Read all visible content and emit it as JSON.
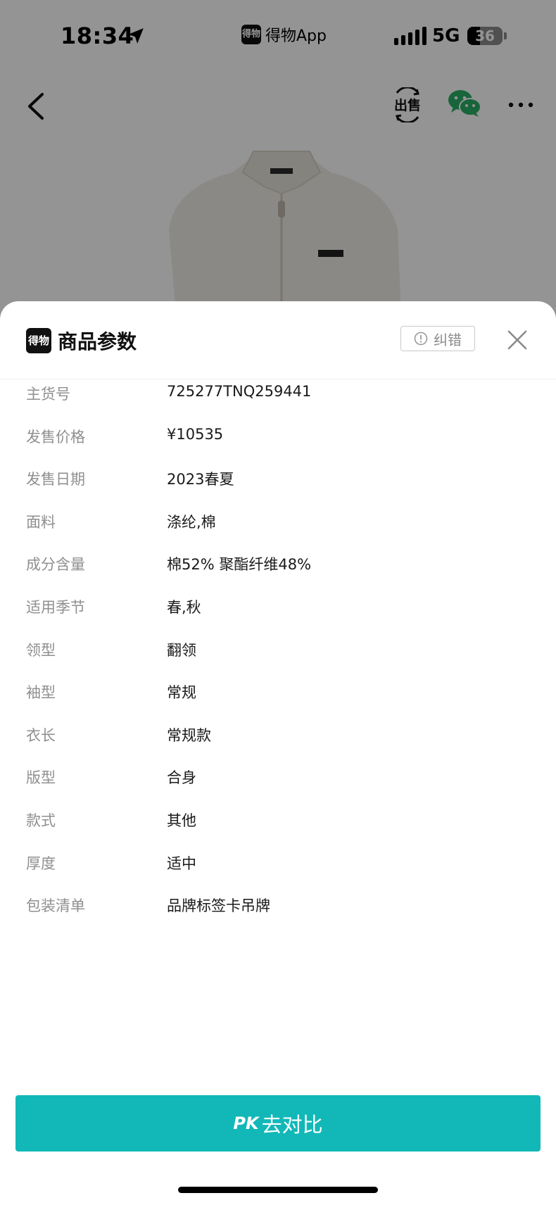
{
  "status_bar": {
    "time": "18:34",
    "app_name": "得物App",
    "app_logo_text": "得物",
    "network": "5G",
    "battery": "36",
    "battery_level": 0.36
  },
  "nav": {
    "back_icon": "chevron-left-icon",
    "sell_label": "出售",
    "wechat_icon": "wechat-icon",
    "more_icon": "more-dots-icon"
  },
  "sheet": {
    "logo_text": "得物",
    "title": "商品参数",
    "report_label": "纠错",
    "close_icon": "close-icon",
    "params": [
      {
        "label": "主货号",
        "value": "725277TNQ259441"
      },
      {
        "label": "发售价格",
        "value": "¥10535"
      },
      {
        "label": "发售日期",
        "value": "2023春夏"
      },
      {
        "label": "面料",
        "value": "涤纶,棉"
      },
      {
        "label": "成分含量",
        "value": "棉52% 聚酯纤维48%"
      },
      {
        "label": "适用季节",
        "value": "春,秋"
      },
      {
        "label": "领型",
        "value": "翻领"
      },
      {
        "label": "袖型",
        "value": "常规"
      },
      {
        "label": "衣长",
        "value": "常规款"
      },
      {
        "label": "版型",
        "value": "合身"
      },
      {
        "label": "款式",
        "value": "其他"
      },
      {
        "label": "厚度",
        "value": "适中"
      },
      {
        "label": "包装清单",
        "value": "品牌标签卡吊牌"
      }
    ],
    "pk_prefix": "PK",
    "pk_label": "去对比"
  },
  "colors": {
    "accent": "#12b8b8",
    "label_gray": "#8f8f8f",
    "value_dark": "#1a1a1a",
    "wechat_green": "#2aae67"
  }
}
